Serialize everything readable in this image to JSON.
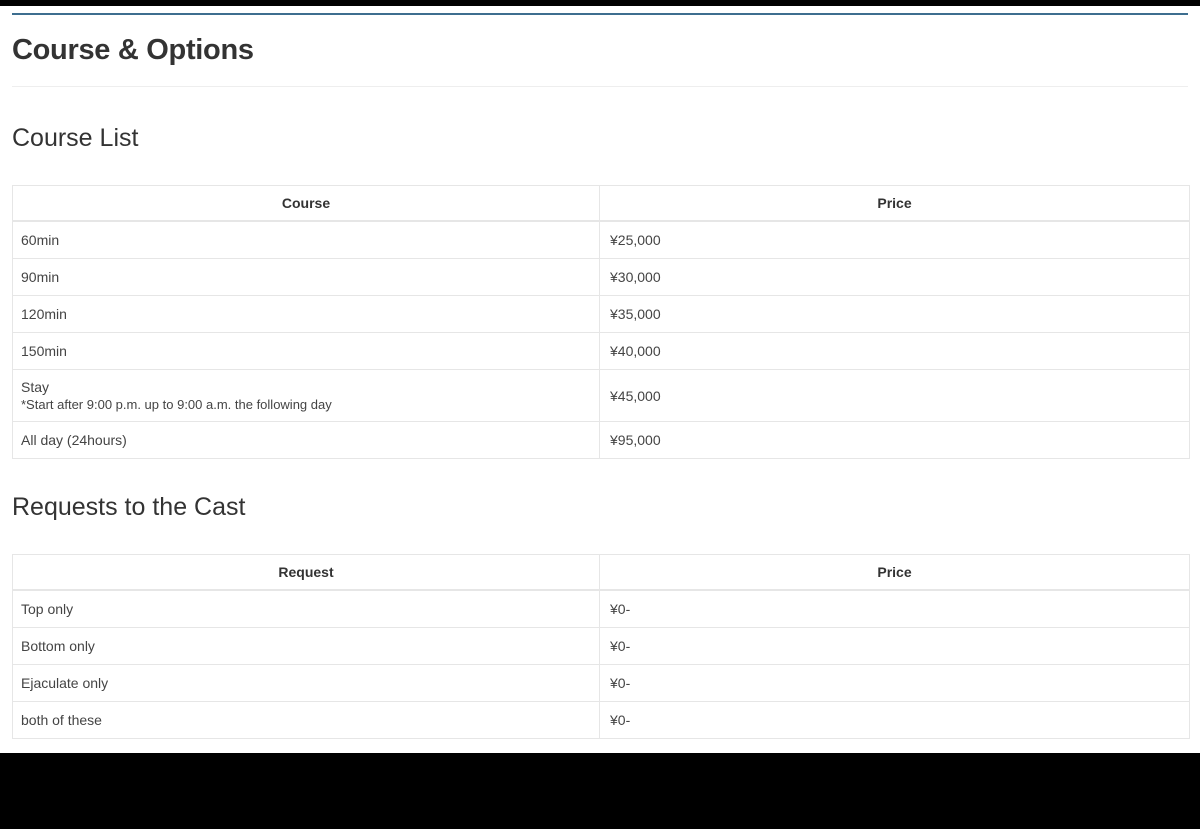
{
  "page": {
    "title": "Course & Options",
    "accent_color": "#3d6e8f"
  },
  "course_section": {
    "title": "Course List",
    "headers": {
      "course": "Course",
      "price": "Price"
    },
    "rows": [
      {
        "course": "60min",
        "note": "",
        "price": "¥25,000"
      },
      {
        "course": "90min",
        "note": "",
        "price": "¥30,000"
      },
      {
        "course": "120min",
        "note": "",
        "price": "¥35,000"
      },
      {
        "course": "150min",
        "note": "",
        "price": "¥40,000"
      },
      {
        "course": "Stay",
        "note": "*Start after 9:00 p.m. up to 9:00 a.m. the following day",
        "price": "¥45,000"
      },
      {
        "course": "All day (24hours)",
        "note": "",
        "price": "¥95,000"
      }
    ]
  },
  "requests_section": {
    "title": "Requests to the Cast",
    "headers": {
      "request": "Request",
      "price": "Price"
    },
    "rows": [
      {
        "request": "Top only",
        "price": "¥0-"
      },
      {
        "request": "Bottom only",
        "price": "¥0-"
      },
      {
        "request": "Ejaculate only",
        "price": "¥0-"
      },
      {
        "request": "both of these",
        "price": "¥0-"
      }
    ]
  }
}
